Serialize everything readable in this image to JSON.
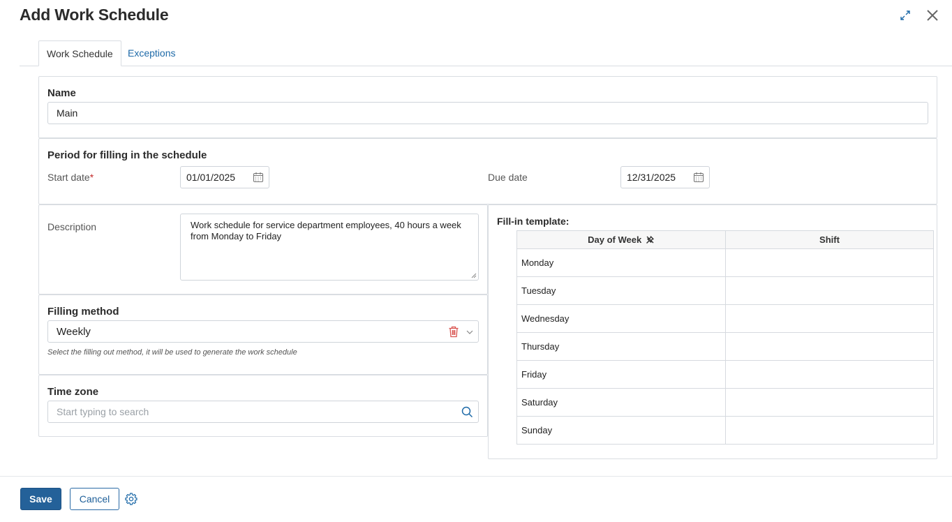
{
  "header": {
    "title": "Add Work Schedule",
    "expand_icon": "expand-arrows-icon",
    "close_icon": "close-icon"
  },
  "tabs": [
    {
      "label": "Work Schedule",
      "active": true
    },
    {
      "label": "Exceptions",
      "active": false
    }
  ],
  "name": {
    "label": "Name",
    "value": "Main"
  },
  "period": {
    "title": "Period for filling in the schedule",
    "start_label": "Start date",
    "required_mark": "*",
    "start_value": "01/01/2025",
    "due_label": "Due date",
    "due_value": "12/31/2025"
  },
  "description": {
    "label": "Description",
    "value": "Work schedule for service department employees, 40 hours a week from Monday to Friday"
  },
  "filling_method": {
    "label": "Filling method",
    "value": "Weekly",
    "hint": "Select the filling out method, it will be used to generate the work schedule"
  },
  "time_zone": {
    "label": "Time zone",
    "placeholder": "Start typing to search"
  },
  "template": {
    "label": "Fill-in template:",
    "columns": [
      "Day of Week",
      "Shift"
    ],
    "rows": [
      {
        "day": "Monday",
        "shift": ""
      },
      {
        "day": "Tuesday",
        "shift": ""
      },
      {
        "day": "Wednesday",
        "shift": ""
      },
      {
        "day": "Thursday",
        "shift": ""
      },
      {
        "day": "Friday",
        "shift": ""
      },
      {
        "day": "Saturday",
        "shift": ""
      },
      {
        "day": "Sunday",
        "shift": ""
      }
    ]
  },
  "footer": {
    "save_label": "Save",
    "cancel_label": "Cancel"
  },
  "colors": {
    "primary": "#246199",
    "link": "#1e6aa8",
    "danger": "#d9534f",
    "border": "#d9dde2"
  }
}
